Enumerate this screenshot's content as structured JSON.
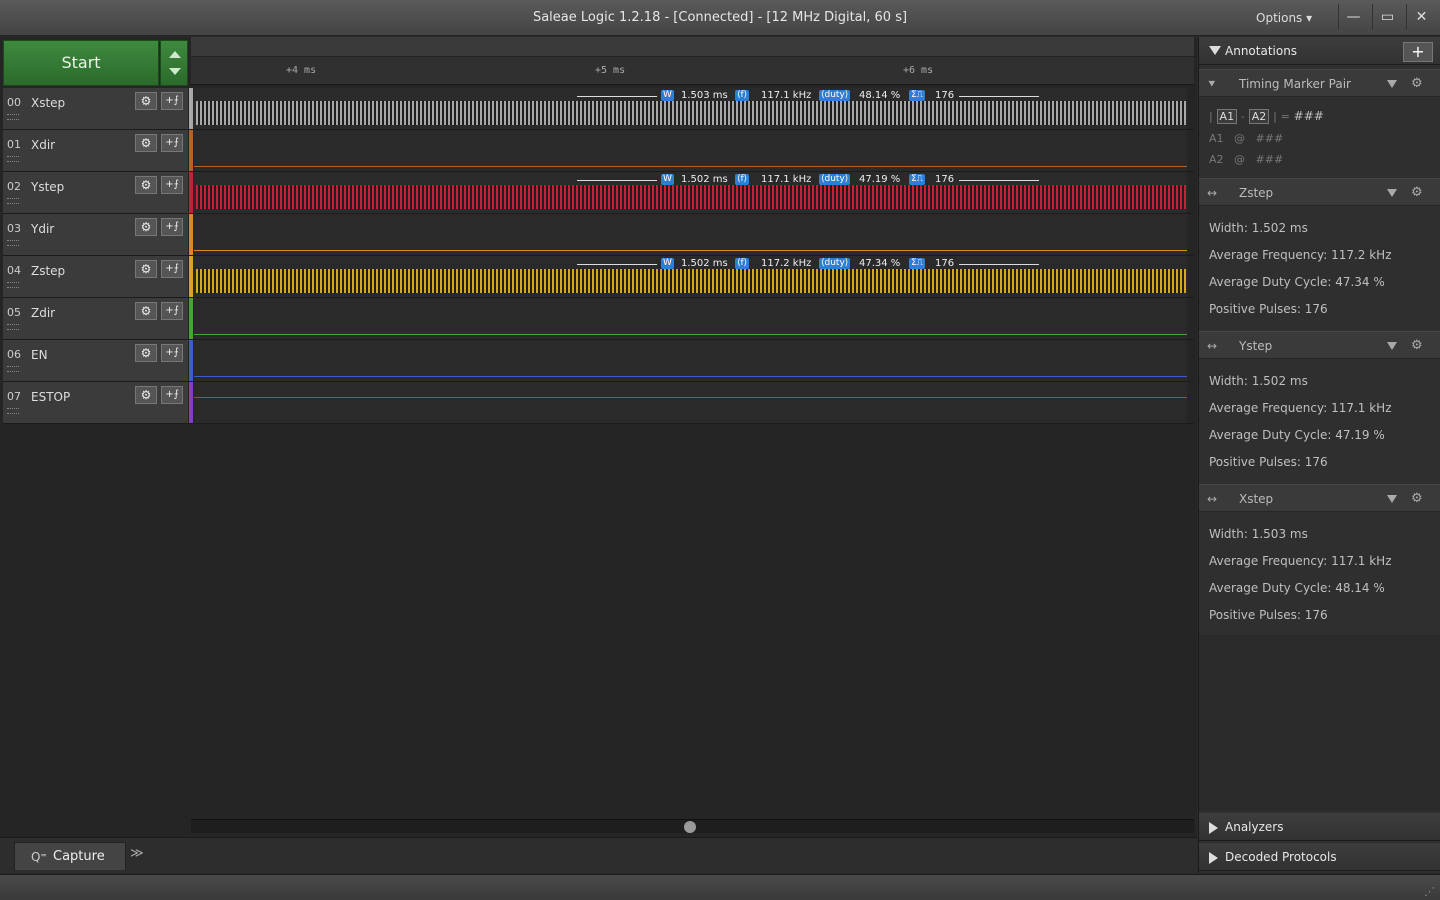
{
  "window": {
    "title": "Saleae Logic 1.2.18 - [Connected] - [12 MHz Digital, 60 s]",
    "options_label": "Options",
    "minimize_glyph": "—",
    "restore_glyph": "▭",
    "close_glyph": "✕"
  },
  "toolbar": {
    "start_label": "Start"
  },
  "ruler": {
    "ticks": [
      "+4 ms",
      "+5 ms",
      "+6 ms"
    ]
  },
  "channels": [
    {
      "num": "00",
      "name": "Xstep",
      "color": "#a8a8a8"
    },
    {
      "num": "01",
      "name": "Xdir",
      "color": "#b2622a"
    },
    {
      "num": "02",
      "name": "Ystep",
      "color": "#c3203a"
    },
    {
      "num": "03",
      "name": "Ydir",
      "color": "#d88a1c"
    },
    {
      "num": "04",
      "name": "Zstep",
      "color": "#d4a81c"
    },
    {
      "num": "05",
      "name": "Zdir",
      "color": "#4aa03a"
    },
    {
      "num": "06",
      "name": "EN",
      "color": "#3a5fc8"
    },
    {
      "num": "07",
      "name": "ESTOP",
      "color": "#8a3ac8"
    }
  ],
  "measurements": [
    {
      "channel": "Xstep",
      "w_chip": "W",
      "width": "1.503 ms",
      "f_chip": "⟨f⟩",
      "freq": "117.1 kHz",
      "duty_chip": "⟨duty⟩",
      "duty": "48.14 %",
      "count_chip": "Σ⎍",
      "count": "176"
    },
    {
      "channel": "Ystep",
      "w_chip": "W",
      "width": "1.502 ms",
      "f_chip": "⟨f⟩",
      "freq": "117.1 kHz",
      "duty_chip": "⟨duty⟩",
      "duty": "47.19 %",
      "count_chip": "Σ⎍",
      "count": "176"
    },
    {
      "channel": "Zstep",
      "w_chip": "W",
      "width": "1.502 ms",
      "f_chip": "⟨f⟩",
      "freq": "117.2 kHz",
      "duty_chip": "⟨duty⟩",
      "duty": "47.34 %",
      "count_chip": "Σ⎍",
      "count": "176"
    }
  ],
  "tabs": {
    "capture_label": "Capture",
    "more_glyph": "≫"
  },
  "annotations": {
    "header": "Annotations",
    "add_glyph": "+",
    "timing_marker_pair": {
      "label": "Timing Marker Pair",
      "pipe_a": "|",
      "a1": "A1",
      "dash": "-",
      "a2": "A2",
      "pipe_b": "|",
      "eq": "=",
      "value": "###",
      "a1_row_label": "A1",
      "a1_row_at": "@",
      "a1_row_value": "###",
      "a2_row_label": "A2",
      "a2_row_at": "@",
      "a2_row_value": "###"
    },
    "groups": [
      {
        "label": "Zstep",
        "width": "Width: 1.502 ms",
        "freq": "Average Frequency: 117.2 kHz",
        "duty": "Average Duty Cycle: 47.34 %",
        "pulses": "Positive Pulses: 176"
      },
      {
        "label": "Ystep",
        "width": "Width: 1.502 ms",
        "freq": "Average Frequency: 117.1 kHz",
        "duty": "Average Duty Cycle: 47.19 %",
        "pulses": "Positive Pulses: 176"
      },
      {
        "label": "Xstep",
        "width": "Width: 1.503 ms",
        "freq": "Average Frequency: 117.1 kHz",
        "duty": "Average Duty Cycle: 48.14 %",
        "pulses": "Positive Pulses: 176"
      }
    ]
  },
  "analyzers": {
    "header": "Analyzers"
  },
  "decoded": {
    "header": "Decoded Protocols"
  },
  "icons": {
    "gear": "⚙",
    "add_analyzer": "+⨍",
    "marker_pin": "⯆",
    "arrows": "↔",
    "capture": "Q⁼",
    "resize_grip": "⋰"
  }
}
